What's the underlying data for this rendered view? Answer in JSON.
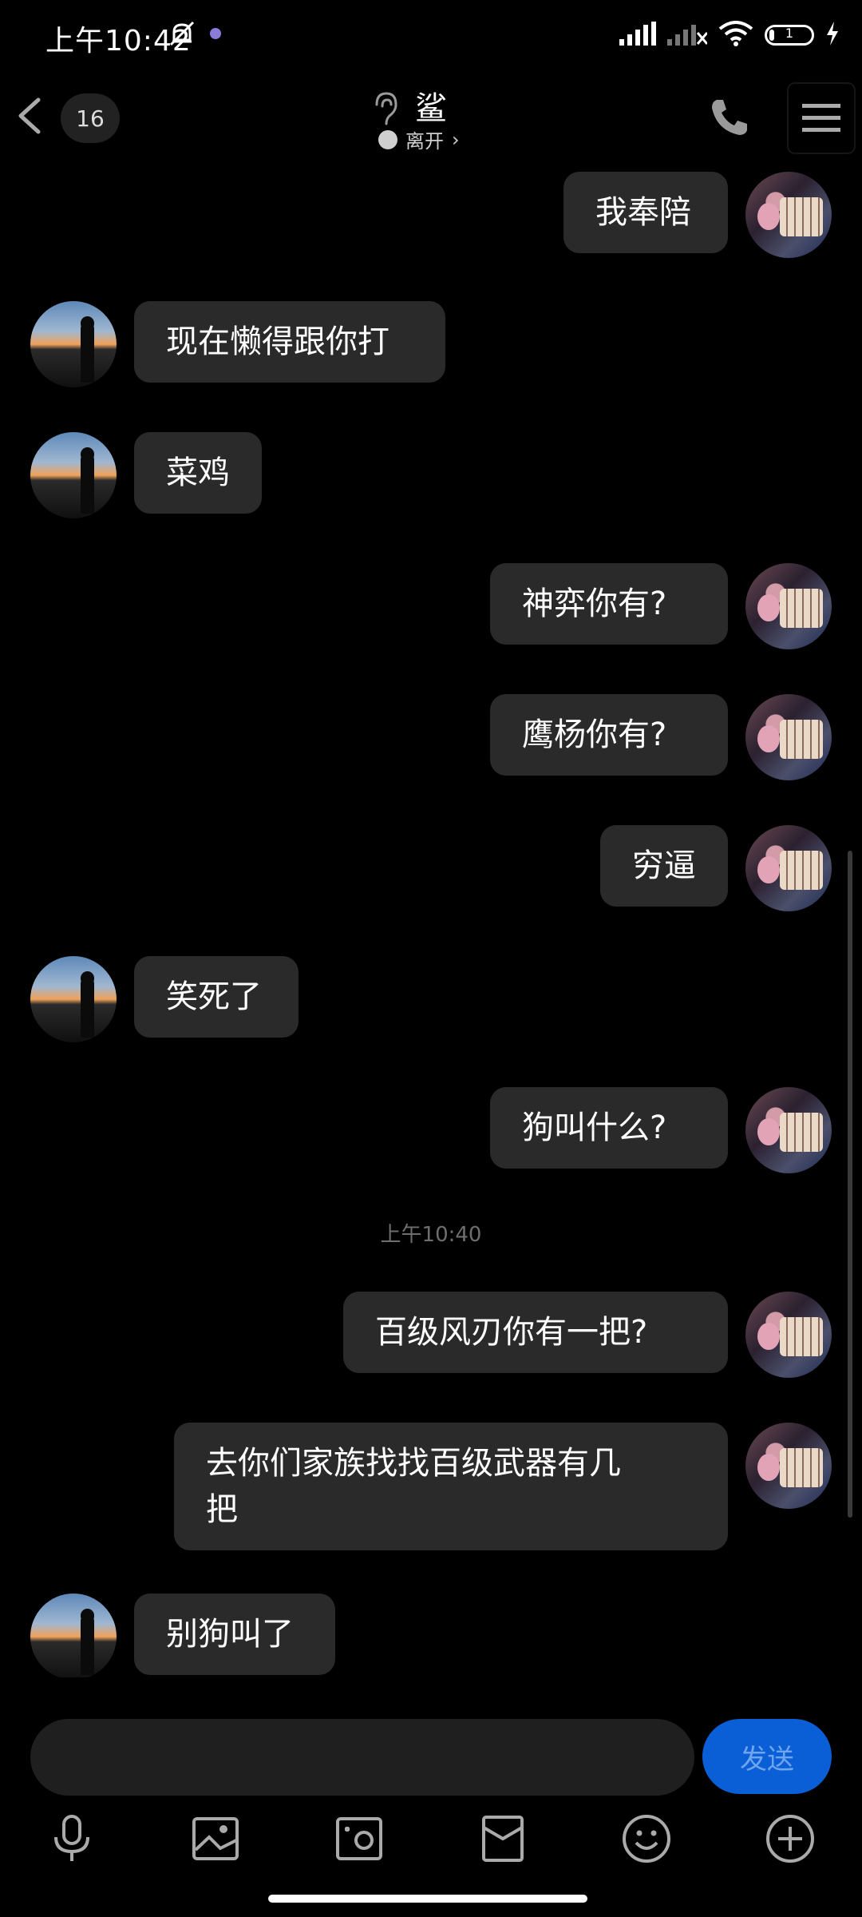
{
  "status_bar": {
    "time": "上午10:42",
    "battery_level": "1",
    "icons": [
      "mute-icon",
      "app-icon",
      "signal-icon",
      "signal-icon",
      "wifi-icon",
      "battery-icon",
      "charging-icon"
    ]
  },
  "header": {
    "unread_count": "16",
    "contact_name": "鲨",
    "presence": "离开",
    "icons": [
      "back-icon",
      "ear-icon",
      "phone-icon",
      "menu-icon"
    ]
  },
  "messages": [
    {
      "side": "me",
      "text": "我奉陪"
    },
    {
      "side": "other",
      "text": "现在懒得跟你打"
    },
    {
      "side": "other",
      "text": "菜鸡"
    },
    {
      "side": "me",
      "text": "神弈你有?"
    },
    {
      "side": "me",
      "text": "鹰杨你有?"
    },
    {
      "side": "me",
      "text": "穷逼"
    },
    {
      "side": "other",
      "text": "笑死了"
    },
    {
      "side": "me",
      "text": "狗叫什么?"
    },
    {
      "side": "time",
      "text": "上午10:40"
    },
    {
      "side": "me",
      "text": "百级风刃你有一把?"
    },
    {
      "side": "me",
      "text": "去你们家族找找百级武器有几\n把"
    },
    {
      "side": "other",
      "text": "别狗叫了"
    }
  ],
  "composer": {
    "input_value": "",
    "send_label": "发送"
  },
  "toolbar": [
    "microphone-icon",
    "image-icon",
    "camera-icon",
    "red-packet-icon",
    "emoji-icon",
    "plus-icon"
  ],
  "colors": {
    "background": "#000000",
    "bubble": "#2a2a2a",
    "send_button": "#0a5fd6"
  }
}
